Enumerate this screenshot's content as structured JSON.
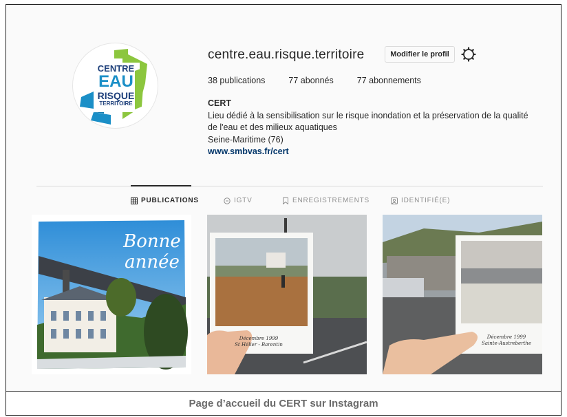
{
  "profile": {
    "username": "centre.eau.risque.territoire",
    "edit_button": "Modifier le profil",
    "gear_icon": "gear-icon",
    "stats": {
      "posts_count": "38",
      "posts_label": "publications",
      "followers_count": "77",
      "followers_label": "abonnés",
      "following_count": "77",
      "following_label": "abonnements"
    },
    "bio": {
      "name": "CERT",
      "line1": "Lieu dédié à la sensibilisation sur le risque inondation et la préservation de la qualité",
      "line2": "de l'eau et des milieux aquatiques",
      "line3": "Seine-Maritime (76)",
      "link": "www.smbvas.fr/cert"
    },
    "logo": {
      "line1": "CENTRE",
      "line2": "EAU",
      "line3": "RISQUE",
      "line4": "TERRITOIRE",
      "colors": {
        "blue": "#1b8fc7",
        "green": "#8cc63e",
        "navy": "#1d3f7a"
      }
    }
  },
  "tabs": [
    {
      "label": "PUBLICATIONS",
      "icon": "grid-icon",
      "active": true
    },
    {
      "label": "IGTV",
      "icon": "igtv-icon",
      "active": false
    },
    {
      "label": "ENREGISTREMENTS",
      "icon": "bookmark-icon",
      "active": false
    },
    {
      "label": "IDENTIFIÉ(E)",
      "icon": "tagged-icon",
      "active": false
    }
  ],
  "posts": [
    {
      "type": "greeting",
      "overlay_line1": "Bonne",
      "overlay_line2": "année"
    },
    {
      "type": "flood-photo",
      "polaroid_line1": "Décembre 1999",
      "polaroid_line2": "St Hélier - Barentin"
    },
    {
      "type": "flood-photo",
      "polaroid_line1": "Décembre 1999",
      "polaroid_line2": "Sainte-Austreberthe"
    }
  ],
  "caption": "Page d’accueil du CERT sur Instagram"
}
